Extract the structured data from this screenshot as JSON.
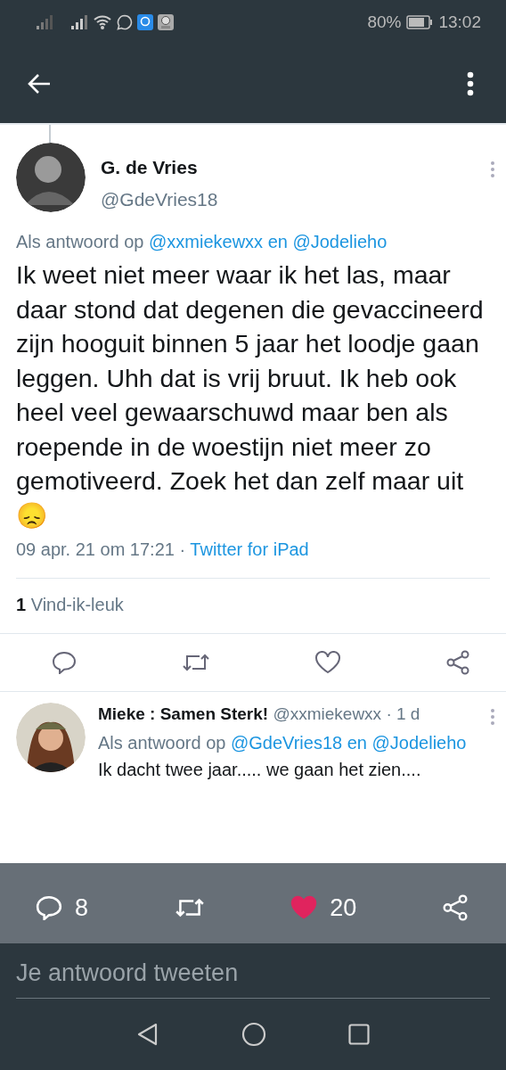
{
  "status_bar": {
    "battery": "80%",
    "time": "13:02"
  },
  "tweet": {
    "name": "G. de Vries",
    "handle": "@GdeVries18",
    "reply_prefix": "Als antwoord op",
    "reply_to": "@xxmiekewxx en @Jodelieho",
    "text": "Ik weet niet meer waar ik het las, maar daar stond dat degenen die gevaccineerd zijn hooguit binnen 5 jaar het loodje gaan leggen. Uhh dat is vrij bruut. Ik heb ook heel veel gewaarschuwd maar ben als roepende in de woestijn niet meer zo gemotiveerd. Zoek het dan zelf maar uit",
    "emoji": "😞",
    "date": "09 apr. 21 om 17:21 ·",
    "source": "Twitter for iPad",
    "likes_count": "1",
    "likes_label": "Vind-ik-leuk"
  },
  "reply": {
    "name": "Mieke : Samen Sterk!",
    "handle": "@xxmiekewxx · 1 d",
    "reply_prefix": "Als antwoord op",
    "reply_to": "@GdeVries18 en @Jodelieho",
    "text": "Ik dacht twee jaar..... we gaan het zien...."
  },
  "action_overlay": {
    "replies": "8",
    "likes": "20",
    "liked": true
  },
  "reply_field": {
    "placeholder": "Je antwoord tweeten"
  }
}
